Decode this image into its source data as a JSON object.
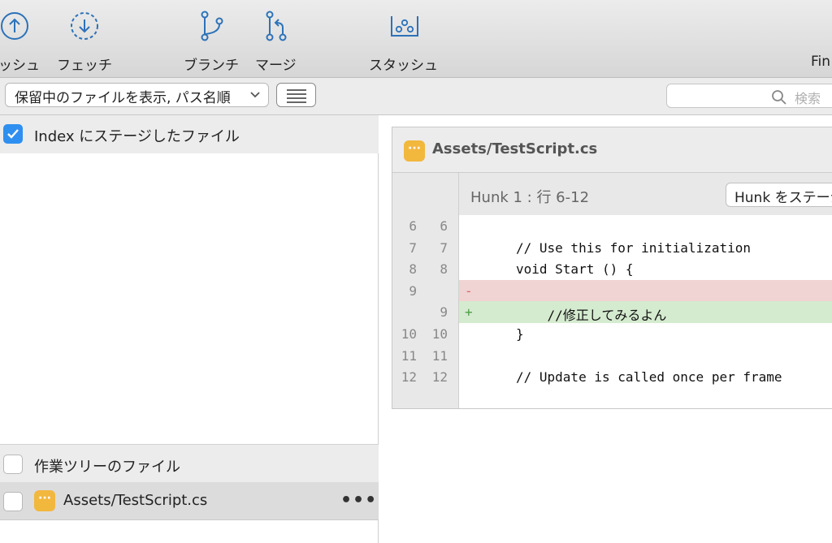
{
  "toolbar": {
    "items": [
      {
        "label": "ッシュ",
        "icon": "push-icon"
      },
      {
        "label": "フェッチ",
        "icon": "fetch-icon"
      },
      {
        "label": "ブランチ",
        "icon": "branch-icon"
      },
      {
        "label": "マージ",
        "icon": "merge-icon"
      },
      {
        "label": "スタッシュ",
        "icon": "stash-icon"
      },
      {
        "label": "Fin",
        "icon": ""
      }
    ]
  },
  "filter": {
    "select_value": "保留中のファイルを表示, パス名順",
    "search_placeholder": "検索"
  },
  "staged": {
    "label": "Index にステージしたファイル",
    "checked": true
  },
  "working": {
    "label": "作業ツリーのファイル",
    "checked": false,
    "files": [
      {
        "name": "Assets/TestScript.cs",
        "more": "•••"
      }
    ]
  },
  "diff": {
    "file_title": "Assets/TestScript.cs",
    "hunk_label": "Hunk 1 : 行 6-12",
    "hunk_button": "Hunk をステージ",
    "lines": [
      {
        "old": "6",
        "new": "6",
        "type": "ctx",
        "mark": "",
        "text": ""
      },
      {
        "old": "7",
        "new": "7",
        "type": "ctx",
        "mark": "",
        "text": "// Use this for initialization"
      },
      {
        "old": "8",
        "new": "8",
        "type": "ctx",
        "mark": "",
        "text": "void Start () {"
      },
      {
        "old": "9",
        "new": "",
        "type": "del",
        "mark": "-",
        "text": ""
      },
      {
        "old": "",
        "new": "9",
        "type": "add",
        "mark": "+",
        "text": "    //修正してみるよん"
      },
      {
        "old": "10",
        "new": "10",
        "type": "ctx",
        "mark": "",
        "text": "}"
      },
      {
        "old": "11",
        "new": "11",
        "type": "ctx",
        "mark": "",
        "text": ""
      },
      {
        "old": "12",
        "new": "12",
        "type": "ctx",
        "mark": "",
        "text": "// Update is called once per frame"
      }
    ]
  },
  "colors": {
    "accent": "#2f8ff0",
    "file_badge": "#f2b73d",
    "deleted_line": "#f0d3d3",
    "added_line": "#d5ebcf"
  }
}
